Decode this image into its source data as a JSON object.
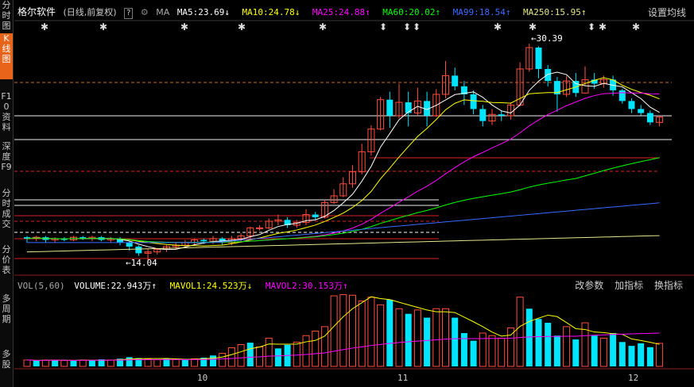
{
  "sidebar": {
    "tabs": [
      {
        "label": "分时图",
        "active": false
      },
      {
        "label": "K线图",
        "active": true
      },
      {
        "label": "F10资料",
        "active": false
      },
      {
        "label": "深度F9",
        "active": false
      },
      {
        "label": "分时成交",
        "active": false
      },
      {
        "label": "分价表",
        "active": false
      },
      {
        "label": "多周期",
        "active": false
      },
      {
        "label": "多股",
        "active": false
      }
    ]
  },
  "header": {
    "stock_name": "格尔软件",
    "mode": "(日线,前复权)",
    "help": "?",
    "ma_label": "MA",
    "settings": "设置均线",
    "ma": [
      {
        "text": "MA5:23.69",
        "arrow": "↓",
        "color": "#ffffff"
      },
      {
        "text": "MA10:24.78",
        "arrow": "↓",
        "color": "#ffff00"
      },
      {
        "text": "MA25:24.88",
        "arrow": "↑",
        "color": "#ff00ff"
      },
      {
        "text": "MA60:20.02",
        "arrow": "↑",
        "color": "#00ff00"
      },
      {
        "text": "MA99:18.54",
        "arrow": "↑",
        "color": "#3a6bff"
      },
      {
        "text": "MA250:15.95",
        "arrow": "↑",
        "color": "#e6e68c"
      }
    ]
  },
  "price_labels": {
    "high": "30.39",
    "low": "14.04"
  },
  "volume_header": {
    "title": "VOL(5,60)",
    "items": [
      {
        "text": "VOLUME:22.943万",
        "arrow": "↑",
        "color": "#ffffff"
      },
      {
        "text": "MAVOL1:24.523万",
        "arrow": "↓",
        "color": "#ffff00"
      },
      {
        "text": "MAVOL2:30.153万",
        "arrow": "↑",
        "color": "#ff00ff"
      }
    ],
    "tools": [
      "改参数",
      "加指标",
      "换指标"
    ]
  },
  "x_labels": [
    "10",
    "11",
    "12"
  ],
  "colors": {
    "up": "#ff4d3d",
    "down": "#00e5ff",
    "background": "#000000"
  },
  "chart_data": {
    "type": "candlestick",
    "price_range": [
      13,
      32
    ],
    "high_marker": 30.39,
    "low_marker": 14.04,
    "candles": [
      [
        15.9,
        15.8,
        16.0,
        15.5
      ],
      [
        15.8,
        15.9,
        16.0,
        15.6
      ],
      [
        15.9,
        15.7,
        16.0,
        15.5
      ],
      [
        15.7,
        15.8,
        15.9,
        15.5
      ],
      [
        15.8,
        15.7,
        15.9,
        15.6
      ],
      [
        15.7,
        15.9,
        16.0,
        15.6
      ],
      [
        15.9,
        15.8,
        16.0,
        15.7
      ],
      [
        15.8,
        15.9,
        16.0,
        15.6
      ],
      [
        15.9,
        15.7,
        16.0,
        15.6
      ],
      [
        15.7,
        15.8,
        15.9,
        15.5
      ],
      [
        15.8,
        15.5,
        15.9,
        15.3
      ],
      [
        15.5,
        15.2,
        15.6,
        14.9
      ],
      [
        15.2,
        14.7,
        15.3,
        14.5
      ],
      [
        14.7,
        14.8,
        15.0,
        14.04
      ],
      [
        14.8,
        15.0,
        15.1,
        14.6
      ],
      [
        15.0,
        15.2,
        15.3,
        14.8
      ],
      [
        15.2,
        15.3,
        15.5,
        15.0
      ],
      [
        15.3,
        15.5,
        15.7,
        15.1
      ],
      [
        15.5,
        15.7,
        15.8,
        15.3
      ],
      [
        15.7,
        15.6,
        15.8,
        15.4
      ],
      [
        15.6,
        15.8,
        16.0,
        15.4
      ],
      [
        15.8,
        15.5,
        15.9,
        15.3
      ],
      [
        15.5,
        15.8,
        16.0,
        15.3
      ],
      [
        15.8,
        16.0,
        16.2,
        15.6
      ],
      [
        16.0,
        16.6,
        16.7,
        15.8
      ],
      [
        16.6,
        16.6,
        16.8,
        16.4
      ],
      [
        16.6,
        17.1,
        17.3,
        16.5
      ],
      [
        17.1,
        17.2,
        17.6,
        16.8
      ],
      [
        17.2,
        16.8,
        17.4,
        16.6
      ],
      [
        16.8,
        17.0,
        17.2,
        16.6
      ],
      [
        17.0,
        17.6,
        18.0,
        16.8
      ],
      [
        17.6,
        17.4,
        17.8,
        17.2
      ],
      [
        17.4,
        18.5,
        18.7,
        17.3
      ],
      [
        18.5,
        19.0,
        19.5,
        18.4
      ],
      [
        19.0,
        19.9,
        20.4,
        18.9
      ],
      [
        19.9,
        20.8,
        21.3,
        19.6
      ],
      [
        20.8,
        22.3,
        22.9,
        20.6
      ],
      [
        22.3,
        24.0,
        24.3,
        22.0
      ],
      [
        24.0,
        26.2,
        26.4,
        23.9
      ],
      [
        26.2,
        25.0,
        26.8,
        24.1
      ],
      [
        25.0,
        26.0,
        27.4,
        24.8
      ],
      [
        26.0,
        25.2,
        26.8,
        24.2
      ],
      [
        25.2,
        26.1,
        27.1,
        25.0
      ],
      [
        26.1,
        25.0,
        26.8,
        24.2
      ],
      [
        25.0,
        26.6,
        27.0,
        24.9
      ],
      [
        26.6,
        28.0,
        29.1,
        26.3
      ],
      [
        28.0,
        27.2,
        28.6,
        26.9
      ],
      [
        27.2,
        26.6,
        27.6,
        25.8
      ],
      [
        26.6,
        25.5,
        26.9,
        25.1
      ],
      [
        25.5,
        24.6,
        25.8,
        24.2
      ],
      [
        24.6,
        25.1,
        25.5,
        24.3
      ],
      [
        25.1,
        25.0,
        25.4,
        24.6
      ],
      [
        25.0,
        25.8,
        26.0,
        24.7
      ],
      [
        25.8,
        28.5,
        29.0,
        25.7
      ],
      [
        28.5,
        30.1,
        30.39,
        28.3
      ],
      [
        30.1,
        28.5,
        30.2,
        27.8
      ],
      [
        28.5,
        27.6,
        28.8,
        27.2
      ],
      [
        27.6,
        26.6,
        27.9,
        25.3
      ],
      [
        26.6,
        27.6,
        28.0,
        26.4
      ],
      [
        27.6,
        26.7,
        28.2,
        26.4
      ],
      [
        26.7,
        27.7,
        28.7,
        27.2
      ],
      [
        27.7,
        27.4,
        28.2,
        27.0
      ],
      [
        27.4,
        27.7,
        28.0,
        27.1
      ],
      [
        27.7,
        26.9,
        28.0,
        26.5
      ],
      [
        26.9,
        26.1,
        27.0,
        25.9
      ],
      [
        26.1,
        25.5,
        26.3,
        25.2
      ],
      [
        25.5,
        25.2,
        25.8,
        25.0
      ],
      [
        25.2,
        24.5,
        25.4,
        24.3
      ],
      [
        24.5,
        24.9,
        25.0,
        24.2
      ]
    ],
    "volume": [
      [
        5.0,
        0
      ],
      [
        4.5,
        1
      ],
      [
        4.8,
        0
      ],
      [
        5.2,
        1
      ],
      [
        4.6,
        0
      ],
      [
        4.3,
        1
      ],
      [
        5.0,
        0
      ],
      [
        4.7,
        1
      ],
      [
        5.5,
        1
      ],
      [
        4.9,
        0
      ],
      [
        6.0,
        1
      ],
      [
        7.2,
        1
      ],
      [
        6.5,
        1
      ],
      [
        5.8,
        0
      ],
      [
        5.2,
        0
      ],
      [
        6.3,
        1
      ],
      [
        5.6,
        0
      ],
      [
        5.1,
        1
      ],
      [
        5.9,
        0
      ],
      [
        6.8,
        1
      ],
      [
        8.5,
        1
      ],
      [
        10.2,
        0
      ],
      [
        14.5,
        0
      ],
      [
        17.0,
        0
      ],
      [
        18.5,
        1
      ],
      [
        15.2,
        0
      ],
      [
        22.0,
        0
      ],
      [
        14.0,
        1
      ],
      [
        16.8,
        1
      ],
      [
        18.9,
        0
      ],
      [
        24.0,
        0
      ],
      [
        27.5,
        0
      ],
      [
        31.0,
        0
      ],
      [
        55.0,
        0
      ],
      [
        56.0,
        0
      ],
      [
        55.5,
        0
      ],
      [
        51.0,
        0
      ],
      [
        54.0,
        0
      ],
      [
        48.0,
        0
      ],
      [
        52.0,
        1
      ],
      [
        45.0,
        0
      ],
      [
        41.0,
        1
      ],
      [
        44.0,
        0
      ],
      [
        38.0,
        1
      ],
      [
        45.0,
        0
      ],
      [
        45.0,
        0
      ],
      [
        38.0,
        1
      ],
      [
        26.0,
        1
      ],
      [
        20.0,
        1
      ],
      [
        26.0,
        0
      ],
      [
        24.0,
        0
      ],
      [
        22.0,
        0
      ],
      [
        30.0,
        0
      ],
      [
        54.0,
        0
      ],
      [
        45.0,
        1
      ],
      [
        37.0,
        1
      ],
      [
        34.0,
        1
      ],
      [
        24.0,
        1
      ],
      [
        31.0,
        0
      ],
      [
        21.0,
        1
      ],
      [
        34.0,
        0
      ],
      [
        24.0,
        1
      ],
      [
        22.0,
        0
      ],
      [
        26.0,
        1
      ],
      [
        19.0,
        1
      ],
      [
        16.0,
        1
      ],
      [
        18.0,
        1
      ],
      [
        15.0,
        1
      ],
      [
        18.0,
        0
      ]
    ],
    "volume_range": [
      0,
      60
    ]
  }
}
